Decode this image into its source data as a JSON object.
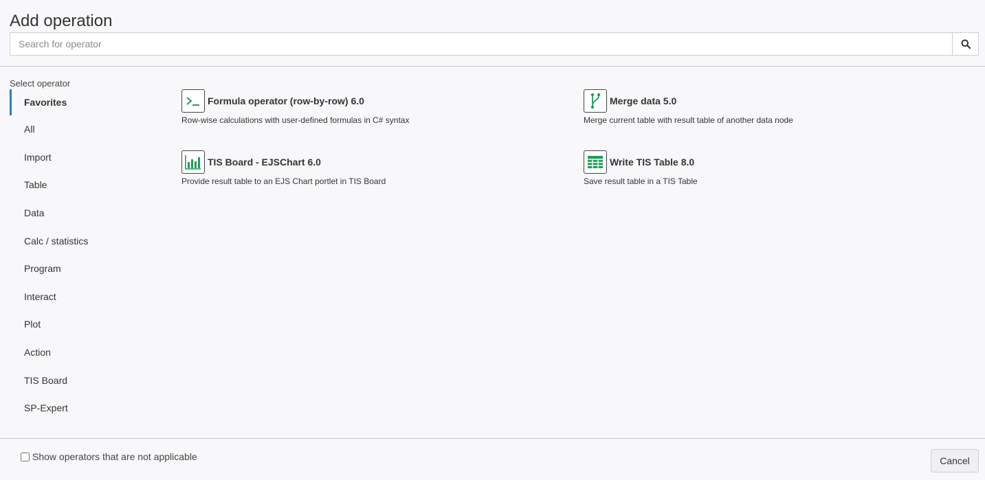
{
  "dialog": {
    "title": "Add operation"
  },
  "search": {
    "placeholder": "Search for operator",
    "value": "",
    "button_icon": "search-icon"
  },
  "sidebar": {
    "label": "Select operator",
    "items": [
      {
        "label": "Favorites",
        "active": true
      },
      {
        "label": "All"
      },
      {
        "label": "Import"
      },
      {
        "label": "Table"
      },
      {
        "label": "Data"
      },
      {
        "label": "Calc / statistics"
      },
      {
        "label": "Program"
      },
      {
        "label": "Interact"
      },
      {
        "label": "Plot"
      },
      {
        "label": "Action"
      },
      {
        "label": "TIS Board"
      },
      {
        "label": "SP-Expert"
      }
    ]
  },
  "operators": [
    {
      "name": "Formula operator (row-by-row) 6.0",
      "description": "Row-wise calculations with user-defined formulas in C# syntax",
      "icon": "terminal-prompt-icon"
    },
    {
      "name": "Merge data 5.0",
      "description": "Merge current table with result table of another data node",
      "icon": "git-branch-icon"
    },
    {
      "name": "TIS Board - EJSChart 6.0",
      "description": "Provide result table to an EJS Chart portlet in TIS Board",
      "icon": "bar-chart-icon"
    },
    {
      "name": "Write TIS Table 8.0",
      "description": "Save result table in a TIS Table",
      "icon": "table-grid-icon"
    }
  ],
  "footer": {
    "checkbox_label": "Show operators that are not applicable",
    "checkbox_checked": false,
    "cancel_label": "Cancel"
  },
  "colors": {
    "accent": "#337ab7",
    "icon_green": "#1e9e5a"
  }
}
